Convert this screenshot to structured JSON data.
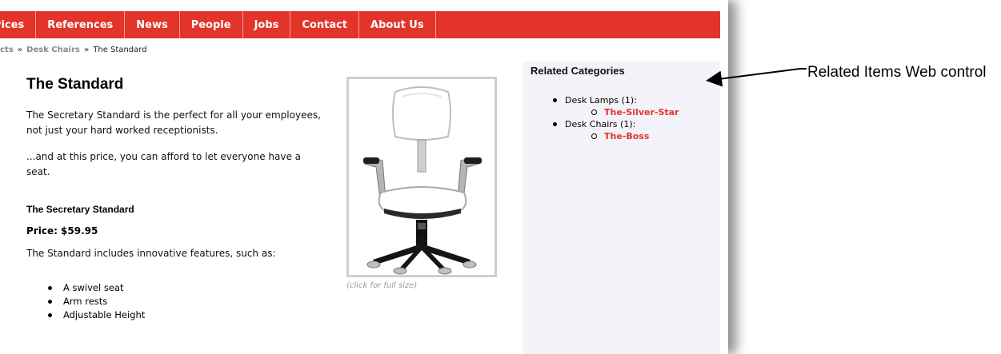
{
  "nav": {
    "items": [
      "vices",
      "References",
      "News",
      "People",
      "Jobs",
      "Contact",
      "About Us"
    ]
  },
  "breadcrumb": {
    "items": [
      "cts",
      "Desk Chairs"
    ],
    "separator": "»",
    "current": "The Standard"
  },
  "product": {
    "title": "The Standard",
    "description_1": "The Secretary Standard is the perfect for all your employees, not just your hard worked receptionists.",
    "description_2": "...and at this price, you can afford to let everyone have a seat.",
    "name": "The Secretary Standard",
    "price": "Price: $59.95",
    "features_intro": "The Standard includes innovative features, such as:",
    "features": [
      "A swivel seat",
      "Arm rests",
      "Adjustable Height"
    ],
    "image_caption": "(click for full size)"
  },
  "sidebar": {
    "title": "Related Categories",
    "categories": [
      {
        "label": "Desk Lamps (1):",
        "items": [
          "The-Silver-Star"
        ]
      },
      {
        "label": "Desk Chairs (1):",
        "items": [
          "The-Boss"
        ]
      }
    ]
  },
  "annotation": {
    "text": "Related Items Web control"
  },
  "colors": {
    "nav_background": "#e3342a",
    "link_red": "#e3342a",
    "sidebar_background": "#f3f3f9"
  }
}
